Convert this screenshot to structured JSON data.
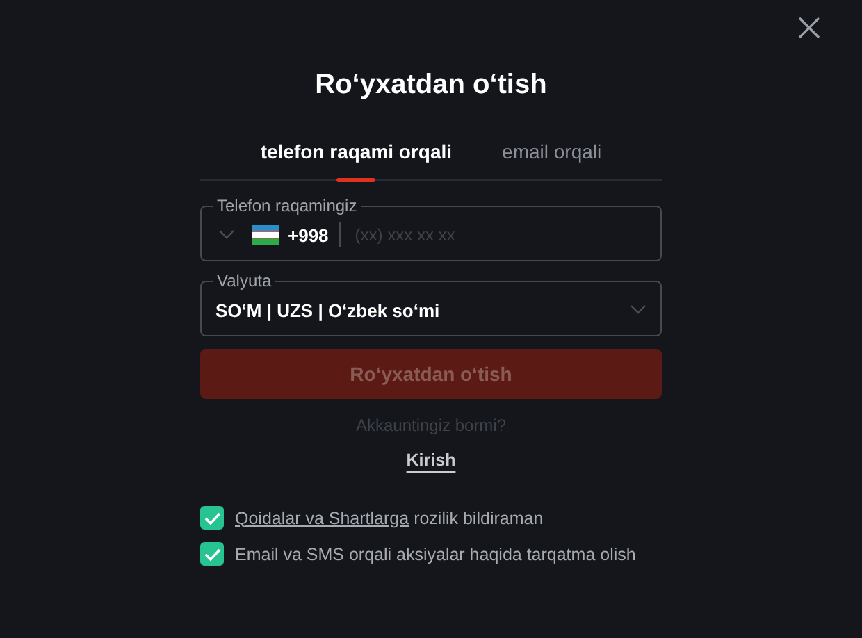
{
  "title": "Ro‘yxatdan o‘tish",
  "tabs": [
    {
      "label": "telefon raqami orqali",
      "selected": true
    },
    {
      "label": "email orqali",
      "selected": false
    }
  ],
  "phone": {
    "label": "Telefon raqamingiz",
    "code": "+998",
    "placeholder": "(xx) xxx xx xx"
  },
  "currency": {
    "label": "Valyuta",
    "value": "SO‘M | UZS | O‘zbek so‘mi"
  },
  "submit": {
    "label": "Ro‘yxatdan o‘tish",
    "disabled": true
  },
  "login_prompt": "Akkauntingiz bormi?",
  "login_link": "Kirish",
  "checkboxes": [
    {
      "link": "Qoidalar va Shartlarga",
      "text": "rozilik bildiraman",
      "checked": true
    },
    {
      "text": "Email va SMS orqali aksiyalar haqida tarqatma olish",
      "checked": true
    }
  ]
}
